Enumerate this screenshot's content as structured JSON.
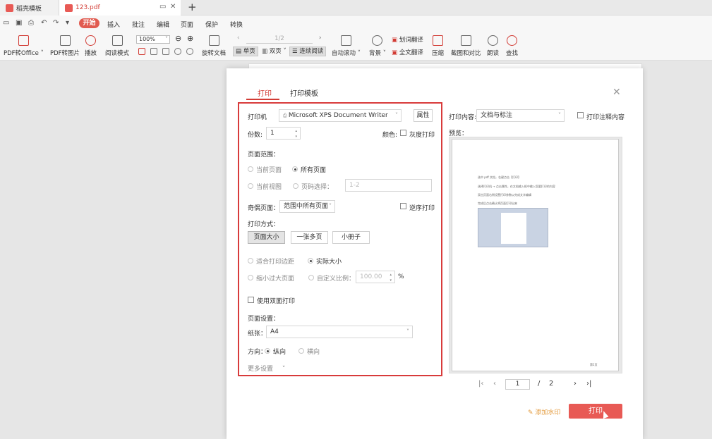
{
  "tabs": [
    {
      "label": "稻壳模板",
      "icon": "docer-icon"
    },
    {
      "label": "123.pdf",
      "icon": "pdf-file-icon"
    }
  ],
  "menus": [
    "插入",
    "批注",
    "编辑",
    "页面",
    "保护",
    "转换"
  ],
  "menu_active": "开始",
  "toolbar": {
    "pdf_to_office": "PDF转Office",
    "pdf_to_image": "PDF转图片",
    "play": "播放",
    "read_mode": "阅读模式",
    "zoom": "100%",
    "rotate": "旋转文档",
    "page_indicator": "1/2",
    "single": "单页",
    "double": "双页",
    "continuous": "连续阅读",
    "auto_scroll": "自动滚动",
    "background": "背景",
    "word_translate": "划词翻译",
    "full_translate": "全文翻译",
    "compress": "压缩",
    "screenshot": "截图和对比",
    "read_aloud": "朗读",
    "find": "查找"
  },
  "dialog": {
    "tab_print": "打印",
    "tab_template": "打印模板",
    "printer_label": "打印机",
    "printer_value": "Microsoft XPS Document Writer",
    "properties": "属性",
    "copies_label": "份数:",
    "copies_value": "1",
    "color_label": "颜色:",
    "grayscale": "灰度打印",
    "range_label": "页面范围：",
    "range_current": "当前页面",
    "range_all": "所有页面",
    "range_view": "当前视图",
    "range_pages": "页码选择：",
    "range_pages_placeholder": "1-2",
    "odd_even_label": "奇偶页面：",
    "odd_even_value": "范围中所有页面",
    "reverse": "逆序打印",
    "mode_label": "打印方式：",
    "mode_page_size": "页面大小",
    "mode_multi": "一张多页",
    "mode_booklet": "小册子",
    "fit_margin": "适合打印边距",
    "actual_size": "实际大小",
    "shrink": "缩小过大页面",
    "custom_scale": "自定义比例：",
    "scale_value": "100.00",
    "percent": "%",
    "duplex": "使用双面打印",
    "page_setup": "页面设置：",
    "paper_label": "纸张：",
    "paper_value": "A4",
    "orientation_label": "方向：",
    "portrait": "纵向",
    "landscape": "横向",
    "more": "更多设置",
    "content_label": "打印内容:",
    "content_value": "文档与标注",
    "print_comments": "打印注释内容",
    "preview_label": "预览：",
    "preview_lines": [
      "选中 pdf 文档，右键点击【打印】",
      "选择打印机 → 点击属性，在文档输入框中输入您要打印的内容",
      "双击页面右侧设置打印参数以完成文字编辑",
      "完成后点击确认将页面打印出来"
    ],
    "preview_footer": "第1页",
    "page_current": "1",
    "page_sep": "/",
    "page_total": "2",
    "add_watermark": "添加水印",
    "print_button": "打印"
  },
  "colors": {
    "accent": "#d23b34",
    "print_button": "#e85a55",
    "highlight_frame": "#d83b3b"
  }
}
